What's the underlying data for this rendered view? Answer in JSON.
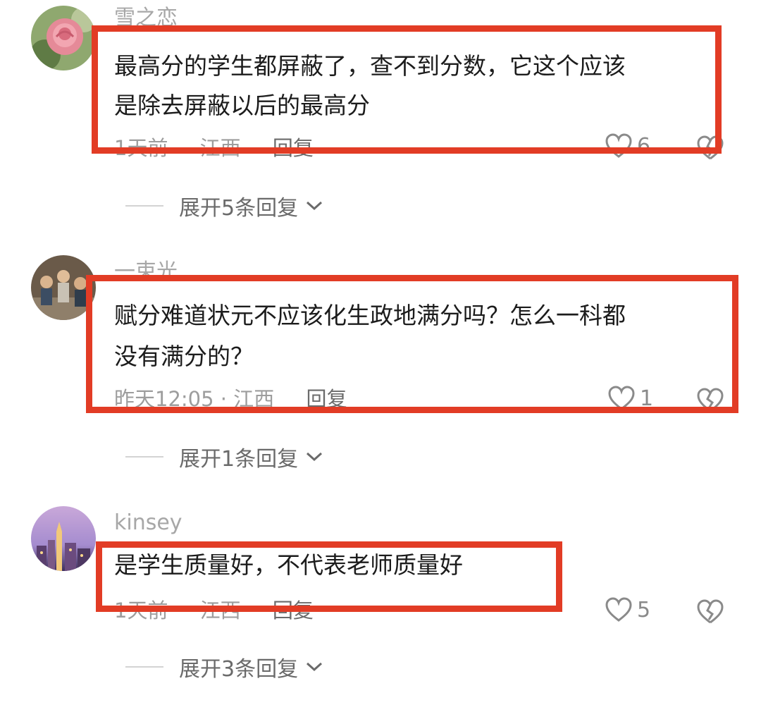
{
  "comments": [
    {
      "username": "雪之恋",
      "lines": [
        "最高分的学生都屏蔽了，查不到分数，它这个应该",
        "是除去屏蔽以后的最高分"
      ],
      "time": "1天前",
      "location": "江西",
      "reply_label": "回复",
      "likes": "6",
      "expand_label": "展开5条回复",
      "avatar_icon": "rose-avatar"
    },
    {
      "username": "一束光",
      "lines": [
        "赋分难道状元不应该化生政地满分吗？怎么一科都",
        "没有满分的？"
      ],
      "time": "昨天12:05 · 江西",
      "location": "",
      "reply_label": "回复",
      "likes": "1",
      "expand_label": "展开1条回复",
      "avatar_icon": "group-photo-avatar"
    },
    {
      "username": "kinsey",
      "lines": [
        "是学生质量好，不代表老师质量好"
      ],
      "time": "1天前",
      "location": "江西",
      "reply_label": "回复",
      "likes": "5",
      "expand_label": "展开3条回复",
      "avatar_icon": "city-night-avatar"
    }
  ],
  "colors": {
    "highlight": "#e23c25",
    "meta": "#9d9d9d",
    "text": "#1c1c1c"
  }
}
